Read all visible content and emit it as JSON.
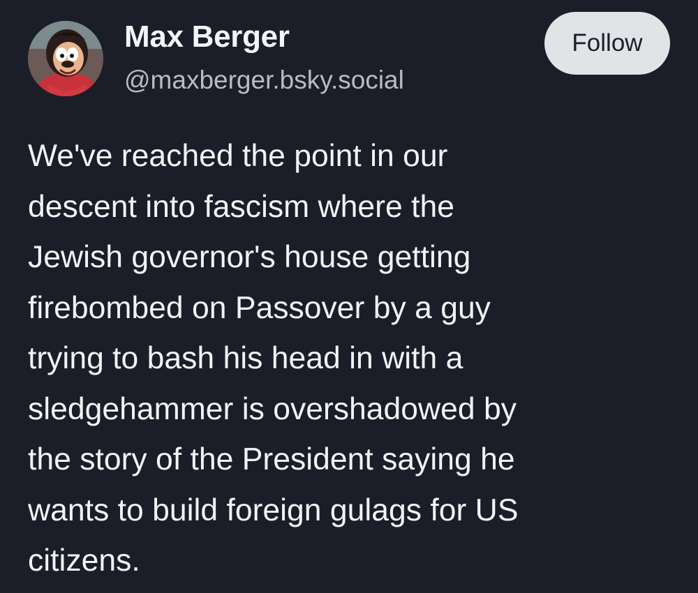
{
  "author": {
    "name": "Max Berger",
    "handle": "@maxberger.bsky.social",
    "avatar_icon": "cartoon-character-avatar"
  },
  "actions": {
    "follow_label": "Follow"
  },
  "post": {
    "lines": [
      "We've reached the point in our",
      "descent into fascism where the",
      "Jewish governor's house getting",
      "firebombed on Passover by a guy",
      "trying to bash his head in with a",
      "sledgehammer is overshadowed by",
      "the story of the President saying he",
      "wants to build foreign gulags for US",
      "citizens."
    ]
  },
  "colors": {
    "background": "#1b1e28",
    "text": "#f2f3f5",
    "handle": "#b7bcc7",
    "button_bg": "#e1e3e7",
    "button_text": "#1b1e28"
  }
}
